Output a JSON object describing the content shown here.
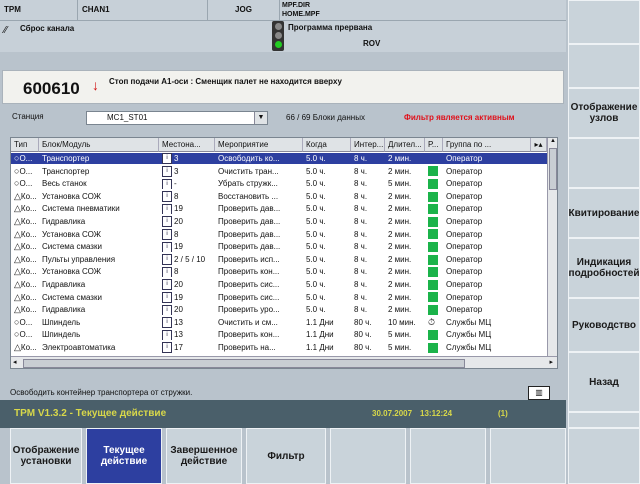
{
  "header": {
    "app": "TPM",
    "channel": "CHAN1",
    "mode": "JOG",
    "prog_dir": "MPF.DIR",
    "prog_file": "HOME.MPF",
    "reset_label": "Сброс канала",
    "prog_state": "Программа прервана",
    "rov": "ROV"
  },
  "alarm": {
    "number": "600610",
    "text": "Стоп подачи A1-оси : Сменщик палет не находится вверху"
  },
  "station": {
    "label": "Станция",
    "value": "MC1_ST01",
    "count": "66 / 69  Блоки данных",
    "filter_msg": "Фильтр является активным"
  },
  "table": {
    "headers": [
      "Тип",
      "Блок/Модуль",
      "Местона...",
      "Мероприятие",
      "Когда",
      "Интер...",
      "Длител...",
      "Р...",
      "Группа по ..."
    ],
    "rows": [
      {
        "type": "О...",
        "icon": "circle",
        "module": "Транспортер",
        "loc": "3",
        "action": "Освободить ко...",
        "when": "5.0 ч.",
        "int": "8 ч.",
        "dur": "2 мин.",
        "p": "",
        "group": "Оператор",
        "sel": true
      },
      {
        "type": "О...",
        "icon": "circle",
        "module": "Транспортер",
        "loc": "3",
        "action": "Очистить тран...",
        "when": "5.0 ч.",
        "int": "8 ч.",
        "dur": "2 мин.",
        "p": "g",
        "group": "Оператор"
      },
      {
        "type": "О...",
        "icon": "circle",
        "module": "Весь станок",
        "loc": "-",
        "action": "Убрать стружк...",
        "when": "5.0 ч.",
        "int": "8 ч.",
        "dur": "5 мин.",
        "p": "g",
        "group": "Оператор"
      },
      {
        "type": "Ко...",
        "icon": "tri",
        "module": "Установка СОЖ",
        "loc": "8",
        "action": "Восстановить ...",
        "when": "5.0 ч.",
        "int": "8 ч.",
        "dur": "2 мин.",
        "p": "g",
        "group": "Оператор"
      },
      {
        "type": "Ко...",
        "icon": "tri",
        "module": "Система пневматики",
        "loc": "19",
        "action": "Проверить дав...",
        "when": "5.0 ч.",
        "int": "8 ч.",
        "dur": "2 мин.",
        "p": "g",
        "group": "Оператор"
      },
      {
        "type": "Ко...",
        "icon": "tri",
        "module": "Гидравлика",
        "loc": "20",
        "action": "Проверить дав...",
        "when": "5.0 ч.",
        "int": "8 ч.",
        "dur": "2 мин.",
        "p": "g",
        "group": "Оператор"
      },
      {
        "type": "Ко...",
        "icon": "tri",
        "module": "Установка СОЖ",
        "loc": "8",
        "action": "Проверить дав...",
        "when": "5.0 ч.",
        "int": "8 ч.",
        "dur": "2 мин.",
        "p": "g",
        "group": "Оператор"
      },
      {
        "type": "Ко...",
        "icon": "tri",
        "module": "Система смазки",
        "loc": "19",
        "action": "Проверить дав...",
        "when": "5.0 ч.",
        "int": "8 ч.",
        "dur": "2 мин.",
        "p": "g",
        "group": "Оператор"
      },
      {
        "type": "Ко...",
        "icon": "tri",
        "module": "Пульты управления",
        "loc": "2 / 5 / 10",
        "action": "Проверить исп...",
        "when": "5.0 ч.",
        "int": "8 ч.",
        "dur": "2 мин.",
        "p": "g",
        "group": "Оператор"
      },
      {
        "type": "Ко...",
        "icon": "tri",
        "module": "Установка СОЖ",
        "loc": "8",
        "action": "Проверить кон...",
        "when": "5.0 ч.",
        "int": "8 ч.",
        "dur": "2 мин.",
        "p": "g",
        "group": "Оператор"
      },
      {
        "type": "Ко...",
        "icon": "tri",
        "module": "Гидравлика",
        "loc": "20",
        "action": "Проверить сис...",
        "when": "5.0 ч.",
        "int": "8 ч.",
        "dur": "2 мин.",
        "p": "g",
        "group": "Оператор"
      },
      {
        "type": "Ко...",
        "icon": "tri",
        "module": "Система смазки",
        "loc": "19",
        "action": "Проверить сис...",
        "when": "5.0 ч.",
        "int": "8 ч.",
        "dur": "2 мин.",
        "p": "g",
        "group": "Оператор"
      },
      {
        "type": "Ко...",
        "icon": "tri",
        "module": "Гидравлика",
        "loc": "20",
        "action": "Проверить уро...",
        "when": "5.0 ч.",
        "int": "8 ч.",
        "dur": "2 мин.",
        "p": "g",
        "group": "Оператор"
      },
      {
        "type": "О...",
        "icon": "circle",
        "module": "Шпиндель",
        "loc": "13",
        "action": "Очистить и см...",
        "when": "1.1 Дни",
        "int": "80 ч.",
        "dur": "10 мин.",
        "p": "clock",
        "group": "Службы МЦ"
      },
      {
        "type": "О...",
        "icon": "circle",
        "module": "Шпиндель",
        "loc": "13",
        "action": "Проверить кон...",
        "when": "1.1 Дни",
        "int": "80 ч.",
        "dur": "5 мин.",
        "p": "g",
        "group": "Службы МЦ"
      },
      {
        "type": "Ко...",
        "icon": "tri",
        "module": "Электроавтоматика",
        "loc": "17",
        "action": "Проверить на...",
        "when": "1.1 Дни",
        "int": "80 ч.",
        "dur": "5 мин.",
        "p": "g",
        "group": "Службы МЦ"
      }
    ]
  },
  "description": "Освободить контейнер транспортера от стружки.",
  "status": {
    "title": "TPM V1.3.2 - Текущее действие",
    "date": "30.07.2007",
    "time": "13:12:24",
    "count": "(1)"
  },
  "softkeys_v": [
    "Отображение узлов",
    "Квитирование",
    "Индикация подробностей",
    "Руководство",
    "Назад"
  ],
  "softkeys_h": [
    "Отображение установки",
    "Текущее действие",
    "Завершенное действие",
    "Фильтр"
  ],
  "colors": {
    "accent": "#2d3fa0",
    "filter": "#e0101a",
    "green": "#1bb34a",
    "status_yellow": "#d8d84a"
  }
}
